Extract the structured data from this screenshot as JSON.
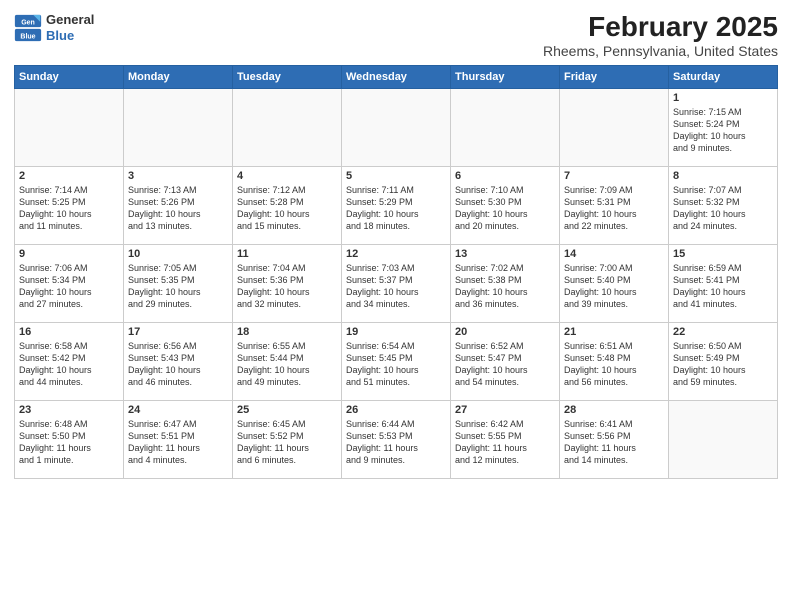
{
  "logo": {
    "general": "General",
    "blue": "Blue"
  },
  "title": "February 2025",
  "location": "Rheems, Pennsylvania, United States",
  "days_header": [
    "Sunday",
    "Monday",
    "Tuesday",
    "Wednesday",
    "Thursday",
    "Friday",
    "Saturday"
  ],
  "weeks": [
    [
      {
        "day": "",
        "info": ""
      },
      {
        "day": "",
        "info": ""
      },
      {
        "day": "",
        "info": ""
      },
      {
        "day": "",
        "info": ""
      },
      {
        "day": "",
        "info": ""
      },
      {
        "day": "",
        "info": ""
      },
      {
        "day": "1",
        "info": "Sunrise: 7:15 AM\nSunset: 5:24 PM\nDaylight: 10 hours\nand 9 minutes."
      }
    ],
    [
      {
        "day": "2",
        "info": "Sunrise: 7:14 AM\nSunset: 5:25 PM\nDaylight: 10 hours\nand 11 minutes."
      },
      {
        "day": "3",
        "info": "Sunrise: 7:13 AM\nSunset: 5:26 PM\nDaylight: 10 hours\nand 13 minutes."
      },
      {
        "day": "4",
        "info": "Sunrise: 7:12 AM\nSunset: 5:28 PM\nDaylight: 10 hours\nand 15 minutes."
      },
      {
        "day": "5",
        "info": "Sunrise: 7:11 AM\nSunset: 5:29 PM\nDaylight: 10 hours\nand 18 minutes."
      },
      {
        "day": "6",
        "info": "Sunrise: 7:10 AM\nSunset: 5:30 PM\nDaylight: 10 hours\nand 20 minutes."
      },
      {
        "day": "7",
        "info": "Sunrise: 7:09 AM\nSunset: 5:31 PM\nDaylight: 10 hours\nand 22 minutes."
      },
      {
        "day": "8",
        "info": "Sunrise: 7:07 AM\nSunset: 5:32 PM\nDaylight: 10 hours\nand 24 minutes."
      }
    ],
    [
      {
        "day": "9",
        "info": "Sunrise: 7:06 AM\nSunset: 5:34 PM\nDaylight: 10 hours\nand 27 minutes."
      },
      {
        "day": "10",
        "info": "Sunrise: 7:05 AM\nSunset: 5:35 PM\nDaylight: 10 hours\nand 29 minutes."
      },
      {
        "day": "11",
        "info": "Sunrise: 7:04 AM\nSunset: 5:36 PM\nDaylight: 10 hours\nand 32 minutes."
      },
      {
        "day": "12",
        "info": "Sunrise: 7:03 AM\nSunset: 5:37 PM\nDaylight: 10 hours\nand 34 minutes."
      },
      {
        "day": "13",
        "info": "Sunrise: 7:02 AM\nSunset: 5:38 PM\nDaylight: 10 hours\nand 36 minutes."
      },
      {
        "day": "14",
        "info": "Sunrise: 7:00 AM\nSunset: 5:40 PM\nDaylight: 10 hours\nand 39 minutes."
      },
      {
        "day": "15",
        "info": "Sunrise: 6:59 AM\nSunset: 5:41 PM\nDaylight: 10 hours\nand 41 minutes."
      }
    ],
    [
      {
        "day": "16",
        "info": "Sunrise: 6:58 AM\nSunset: 5:42 PM\nDaylight: 10 hours\nand 44 minutes."
      },
      {
        "day": "17",
        "info": "Sunrise: 6:56 AM\nSunset: 5:43 PM\nDaylight: 10 hours\nand 46 minutes."
      },
      {
        "day": "18",
        "info": "Sunrise: 6:55 AM\nSunset: 5:44 PM\nDaylight: 10 hours\nand 49 minutes."
      },
      {
        "day": "19",
        "info": "Sunrise: 6:54 AM\nSunset: 5:45 PM\nDaylight: 10 hours\nand 51 minutes."
      },
      {
        "day": "20",
        "info": "Sunrise: 6:52 AM\nSunset: 5:47 PM\nDaylight: 10 hours\nand 54 minutes."
      },
      {
        "day": "21",
        "info": "Sunrise: 6:51 AM\nSunset: 5:48 PM\nDaylight: 10 hours\nand 56 minutes."
      },
      {
        "day": "22",
        "info": "Sunrise: 6:50 AM\nSunset: 5:49 PM\nDaylight: 10 hours\nand 59 minutes."
      }
    ],
    [
      {
        "day": "23",
        "info": "Sunrise: 6:48 AM\nSunset: 5:50 PM\nDaylight: 11 hours\nand 1 minute."
      },
      {
        "day": "24",
        "info": "Sunrise: 6:47 AM\nSunset: 5:51 PM\nDaylight: 11 hours\nand 4 minutes."
      },
      {
        "day": "25",
        "info": "Sunrise: 6:45 AM\nSunset: 5:52 PM\nDaylight: 11 hours\nand 6 minutes."
      },
      {
        "day": "26",
        "info": "Sunrise: 6:44 AM\nSunset: 5:53 PM\nDaylight: 11 hours\nand 9 minutes."
      },
      {
        "day": "27",
        "info": "Sunrise: 6:42 AM\nSunset: 5:55 PM\nDaylight: 11 hours\nand 12 minutes."
      },
      {
        "day": "28",
        "info": "Sunrise: 6:41 AM\nSunset: 5:56 PM\nDaylight: 11 hours\nand 14 minutes."
      },
      {
        "day": "",
        "info": ""
      }
    ]
  ]
}
